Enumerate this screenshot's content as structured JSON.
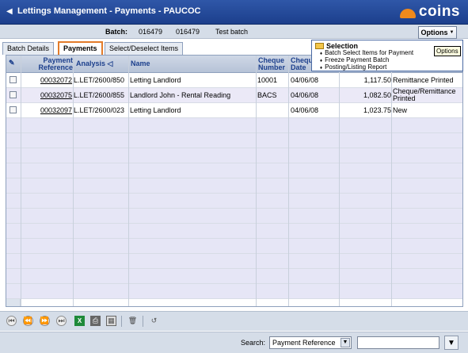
{
  "window": {
    "title": "Lettings Management - Payments - PAUCOC",
    "logo_text": "coins"
  },
  "batch": {
    "label": "Batch:",
    "number": "016479",
    "code": "016479",
    "description": "Test batch"
  },
  "options": {
    "label": "Options",
    "tooltip": "Options"
  },
  "tabs": [
    {
      "label": "Batch Details"
    },
    {
      "label": "Payments"
    },
    {
      "label": "Select/Deselect Items"
    }
  ],
  "menu": {
    "heading": "Selection",
    "items": [
      {
        "label": "Batch Select Items for Payment"
      },
      {
        "label": "Freeze Payment Batch"
      },
      {
        "label": "Posting/Listing Report"
      }
    ]
  },
  "columns": {
    "ref_line1": "Payment",
    "ref_line2": "Reference",
    "analysis": "Analysis",
    "name": "Name",
    "cheque_line1": "Cheque",
    "cheque_line2": "Number",
    "date_line1": "Cheque",
    "date_line2": "Date"
  },
  "rows": [
    {
      "ref": "00032072",
      "analysis": "L.LET/2600/850",
      "name": "Letting Landlord",
      "cheque": "10001",
      "date": "04/06/08",
      "amount": "1,117.50",
      "status": "Remittance Printed"
    },
    {
      "ref": "00032075",
      "analysis": "L.LET/2600/855",
      "name": "Landlord John - Rental Reading",
      "cheque": "BACS",
      "date": "04/06/08",
      "amount": "1,082.50",
      "status": "Cheque/Remittance Printed"
    },
    {
      "ref": "00032097",
      "analysis": "L.LET/2600/023",
      "name": "Letting Landlord",
      "cheque": "",
      "date": "04/06/08",
      "amount": "1,023.75",
      "status": "New"
    }
  ],
  "search": {
    "label": "Search:",
    "selected": "Payment Reference",
    "value": ""
  },
  "icons": [
    "first-icon",
    "prev-icon",
    "next-icon",
    "last-icon",
    "excel-icon",
    "print-icon",
    "calculator-icon",
    "delete-icon",
    "undo-icon",
    "filter-icon"
  ]
}
